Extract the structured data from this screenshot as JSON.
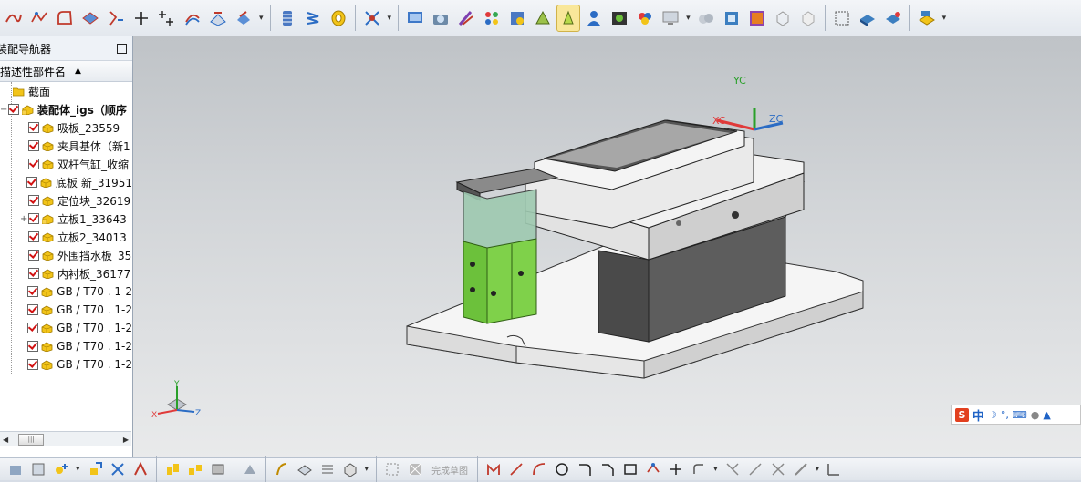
{
  "toolbar_top": {
    "icons": [
      "spline-icon",
      "studio-spline-icon",
      "fillet-curve-icon",
      "plane-icon",
      "point-set-icon",
      "plus-point-icon",
      "points-icon",
      "offset-curve-icon",
      "project-curve-icon",
      "extract-icon",
      "layer-icon",
      "spring-icon",
      "coil-icon",
      "trim-icon",
      "display-icon",
      "camera-icon",
      "pen-icon",
      "palette-icon",
      "shade-icon",
      "light-icon",
      "spotlight-icon",
      "person-icon",
      "photo-icon",
      "materials-icon",
      "monitor-icon",
      "clouds-icon",
      "cube-icon",
      "image-icon",
      "cube-outline-icon",
      "cube-outline2-icon",
      "window-icon",
      "block-blue-icon",
      "block-red-icon",
      "measure-icon"
    ],
    "active_icon": "spotlight-icon"
  },
  "navigator": {
    "title": "装配导航器",
    "column_name": "描述性部件名",
    "items": [
      {
        "label": "截面",
        "kind": "folder",
        "checked": false,
        "bold": false,
        "expander": ""
      },
      {
        "label": "装配体_igs（顺序",
        "kind": "assembly",
        "checked": true,
        "bold": true,
        "expander": "−"
      },
      {
        "label": "吸板_23559",
        "kind": "part",
        "checked": true,
        "bold": false,
        "expander": ""
      },
      {
        "label": "夹具基体（新1",
        "kind": "part",
        "checked": true,
        "bold": false,
        "expander": ""
      },
      {
        "label": "双杆气缸_收缩",
        "kind": "part",
        "checked": true,
        "bold": false,
        "expander": ""
      },
      {
        "label": "底板 新_31951",
        "kind": "part",
        "checked": true,
        "bold": false,
        "expander": ""
      },
      {
        "label": "定位块_32619",
        "kind": "part",
        "checked": true,
        "bold": false,
        "expander": ""
      },
      {
        "label": "立板1_33643",
        "kind": "assembly",
        "checked": true,
        "bold": false,
        "expander": "+"
      },
      {
        "label": "立板2_34013",
        "kind": "part",
        "checked": true,
        "bold": false,
        "expander": ""
      },
      {
        "label": "外围挡水板_35",
        "kind": "part",
        "checked": true,
        "bold": false,
        "expander": ""
      },
      {
        "label": "内衬板_36177",
        "kind": "part",
        "checked": true,
        "bold": false,
        "expander": ""
      },
      {
        "label": "GB / T70 . 1-2",
        "kind": "part",
        "checked": true,
        "bold": false,
        "expander": ""
      },
      {
        "label": "GB / T70 . 1-2",
        "kind": "part",
        "checked": true,
        "bold": false,
        "expander": ""
      },
      {
        "label": "GB / T70 . 1-2",
        "kind": "part",
        "checked": true,
        "bold": false,
        "expander": ""
      },
      {
        "label": "GB / T70 . 1-2",
        "kind": "part",
        "checked": true,
        "bold": false,
        "expander": ""
      },
      {
        "label": "GB / T70 . 1-2",
        "kind": "part",
        "checked": true,
        "bold": false,
        "expander": ""
      }
    ],
    "scroll_thumb": "|||"
  },
  "viewport": {
    "wcs": {
      "x": "XC",
      "y": "YC",
      "z": "ZC"
    },
    "triad": {
      "x": "X",
      "y": "Y",
      "z": "Z"
    }
  },
  "ime_bar": {
    "logo": "S",
    "mode": "中"
  },
  "bottom_bar": {
    "finish_sketch": "完成草图"
  },
  "colors": {
    "accent_green": "#6cc13b",
    "check_red": "#d21212",
    "toolbar_bg": "#e9edf2"
  }
}
